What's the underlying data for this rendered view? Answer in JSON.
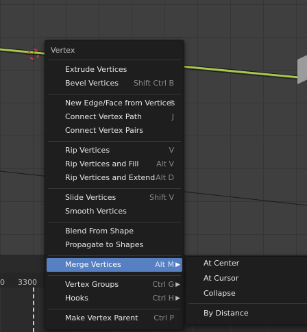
{
  "menu": {
    "title": "Vertex",
    "items": [
      {
        "label": "Extrude Vertices",
        "shortcut": ""
      },
      {
        "label": "Bevel Vertices",
        "shortcut": "Shift Ctrl B"
      },
      {
        "label": "New Edge/Face from Vertices",
        "shortcut": "F"
      },
      {
        "label": "Connect Vertex Path",
        "shortcut": "J"
      },
      {
        "label": "Connect Vertex Pairs",
        "shortcut": ""
      },
      {
        "label": "Rip Vertices",
        "shortcut": "V"
      },
      {
        "label": "Rip Vertices and Fill",
        "shortcut": "Alt V"
      },
      {
        "label": "Rip Vertices and Extend",
        "shortcut": "Alt D"
      },
      {
        "label": "Slide Vertices",
        "shortcut": "Shift V"
      },
      {
        "label": "Smooth Vertices",
        "shortcut": ""
      },
      {
        "label": "Blend From Shape",
        "shortcut": ""
      },
      {
        "label": "Propagate to Shapes",
        "shortcut": ""
      },
      {
        "label": "Merge Vertices",
        "shortcut": "Alt M"
      },
      {
        "label": "Vertex Groups",
        "shortcut": "Ctrl G"
      },
      {
        "label": "Hooks",
        "shortcut": "Ctrl H"
      },
      {
        "label": "Make Vertex Parent",
        "shortcut": "Ctrl P"
      }
    ]
  },
  "submenu": {
    "items": [
      {
        "label": "At Center"
      },
      {
        "label": "At Cursor"
      },
      {
        "label": "Collapse"
      },
      {
        "label": "By Distance"
      }
    ]
  },
  "timeline": {
    "ruler_labels": [
      "0",
      "3300"
    ]
  },
  "colors": {
    "highlight": "#5680c2",
    "menu_bg": "#1e1e1e",
    "selected_edge": "#a9c94a",
    "cursor_ring": "#e0353a"
  }
}
